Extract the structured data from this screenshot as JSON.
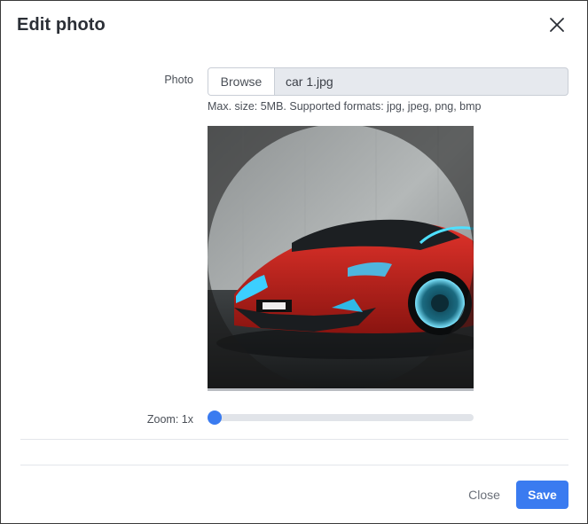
{
  "dialog": {
    "title": "Edit photo",
    "close_icon": "close-icon"
  },
  "photo_field": {
    "label": "Photo",
    "browse_label": "Browse",
    "file_name": "car 1.jpg",
    "hint": "Max. size: 5MB. Supported formats: jpg, jpeg, png, bmp"
  },
  "zoom": {
    "label": "Zoom: 1x",
    "value_fraction": 0
  },
  "footer": {
    "close_label": "Close",
    "save_label": "Save"
  },
  "colors": {
    "accent": "#3a7bf0",
    "track": "#e1e4e9"
  }
}
